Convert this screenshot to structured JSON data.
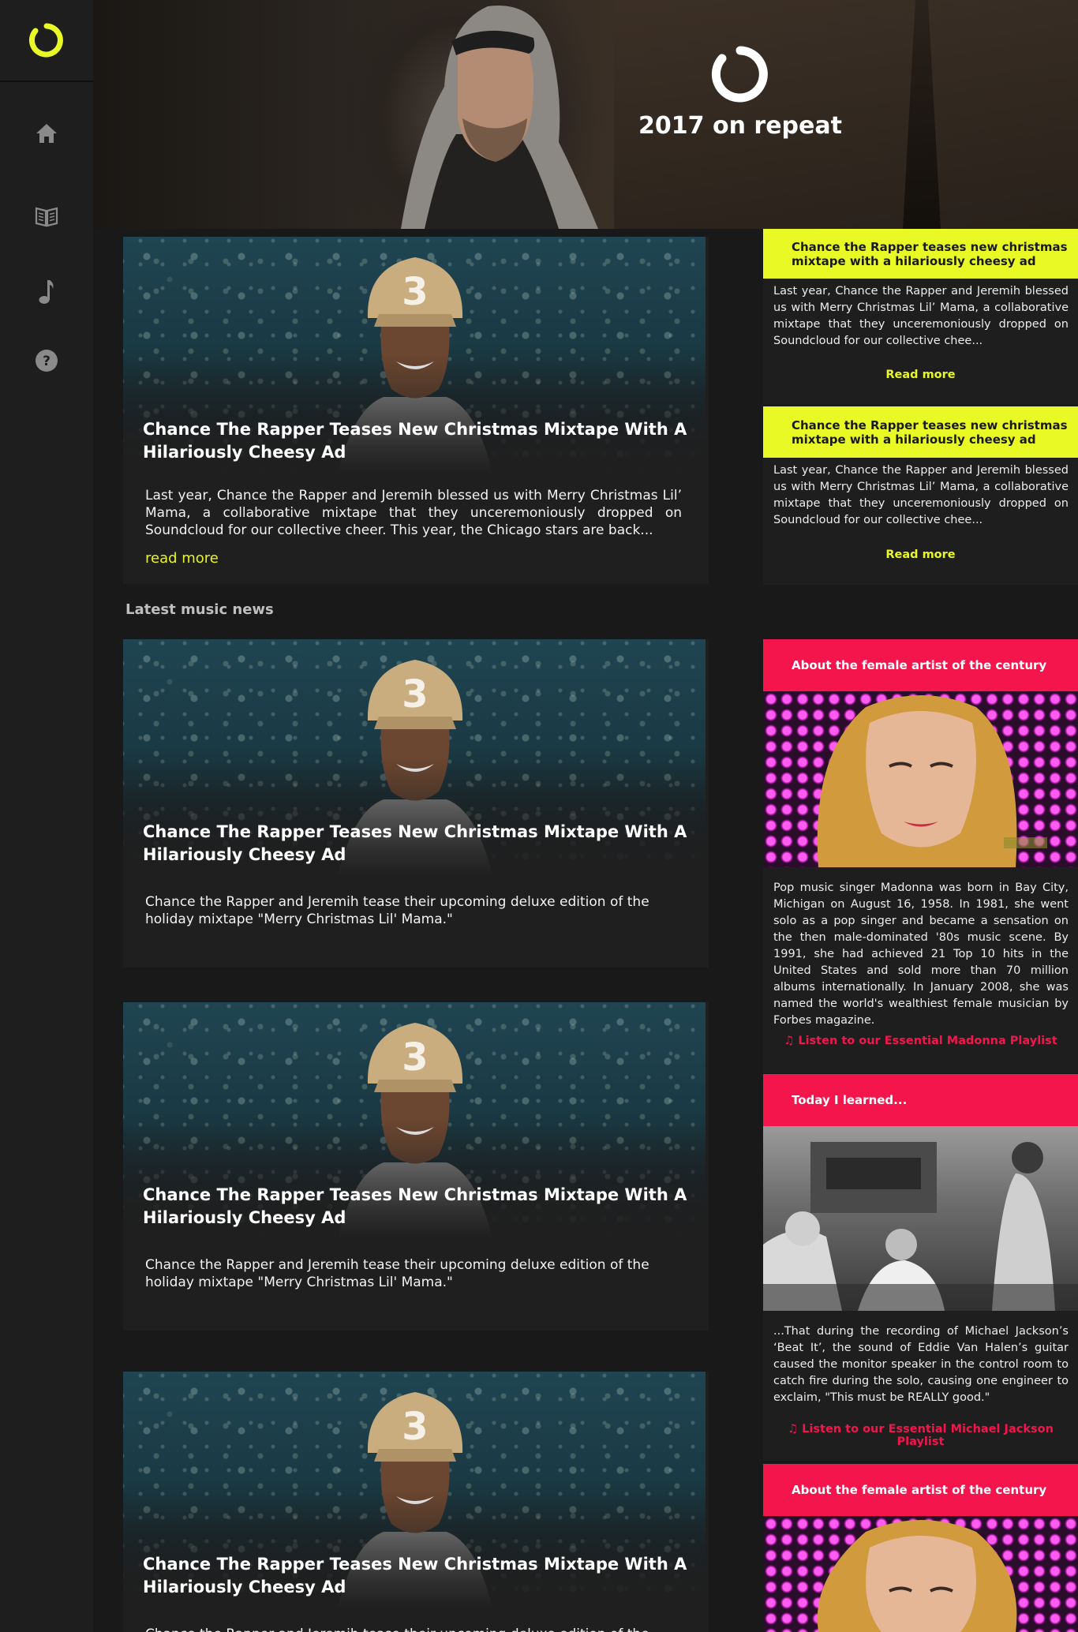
{
  "hero": {
    "title": "2017 on repeat",
    "accent_color": "#e9f925"
  },
  "sidebar": {
    "items": [
      {
        "icon": "home-icon"
      },
      {
        "icon": "open-book-icon"
      },
      {
        "icon": "music-note-icon"
      },
      {
        "icon": "help-icon"
      }
    ]
  },
  "featured": {
    "title": "Chance The Rapper Teases New Christmas Mixtape With A Hilariously Cheesy Ad",
    "body": "Last year, Chance the Rapper and Jeremih blessed us with Merry Christmas Lil’ Mama, a collaborative mixtape that they unceremoniously dropped on Soundcloud for our collective cheer. This year, the Chicago stars are back...",
    "read_more": "read more"
  },
  "latest": {
    "heading": "Latest music news",
    "cards": [
      {
        "title": "Chance The Rapper Teases New Christmas Mixtape With A Hilariously Cheesy Ad",
        "body": "Chance the Rapper and Jeremih tease their upcoming deluxe edition of the holiday mixtape \"Merry Christmas Lil' Mama.\""
      },
      {
        "title": "Chance The Rapper Teases New Christmas Mixtape With A Hilariously Cheesy Ad",
        "body": "Chance the Rapper and Jeremih tease their upcoming deluxe edition of the holiday mixtape \"Merry Christmas Lil' Mama.\""
      },
      {
        "title": "Chance The Rapper Teases New Christmas Mixtape With A Hilariously Cheesy Ad",
        "body": "Chance the Rapper and Jeremih tease their upcoming deluxe edition of the holiday mixtape \"Merry Christmas Lil' Mama.\""
      }
    ]
  },
  "right": {
    "news": [
      {
        "title": "Chance the Rapper teases  new christmas mixtape with a hilariously cheesy ad",
        "body": "Last year, Chance the Rapper and Jeremih blessed us with Merry Christmas Lil’ Mama, a collaborative mixtape that they unceremoniously dropped on Soundcloud for our collective chee...",
        "link": "Read more"
      },
      {
        "title": "Chance the Rapper teases  new christmas mixtape with a hilariously cheesy ad",
        "body": "Last year, Chance the Rapper and Jeremih blessed us with Merry Christmas Lil’ Mama, a collaborative mixtape that they unceremoniously dropped on Soundcloud for our collective chee...",
        "link": "Read more"
      }
    ],
    "artist": {
      "title": "About the female artist of the century",
      "body": "Pop music singer Madonna was born in Bay City, Michigan on August 16, 1958. In 1981, she went solo as a pop singer and became a sensation on the then male-dominated '80s music scene. By 1991, she had achieved 21 Top 10 hits in the United States and sold more than 70 million albums internationally. In January 2008, she was named the world's wealthiest female musician by Forbes magazine.",
      "link": "Listen to our Essential Madonna Playlist"
    },
    "til": {
      "title": "Today I learned...",
      "body": "...That during the recording of Michael Jackson’s ‘Beat It’, the sound of Eddie Van Halen’s guitar caused the monitor speaker in the control room to catch fire during the solo, causing one engineer to exclaim, \"This must be REALLY good.\"",
      "link": "Listen to our Essential Michael Jackson Playlist"
    },
    "artist2": {
      "title": "About the female artist of the century"
    },
    "colors": {
      "yellow": "#e9f925",
      "pink": "#f5154d"
    }
  }
}
